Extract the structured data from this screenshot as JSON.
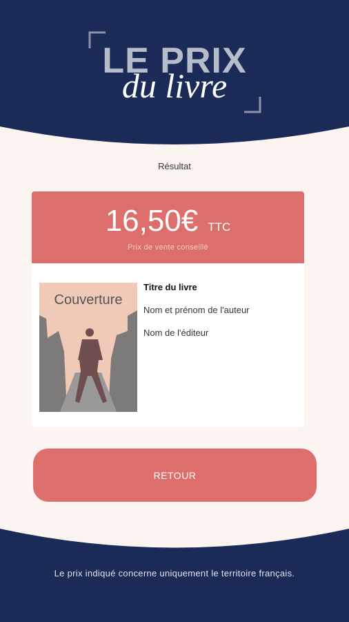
{
  "header": {
    "logo_title": "LE PRIX",
    "logo_subtitle": "du livre"
  },
  "result": {
    "label": "Résultat"
  },
  "price_card": {
    "price": "16,50€",
    "tax_label": "TTC",
    "note": "Prix de vente conseillé",
    "cover_label": "Couverture",
    "book_title": "Titre du livre",
    "author": "Nom et prénom de l'auteur",
    "publisher": "Nom de l'éditeur"
  },
  "actions": {
    "back_label": "RETOUR"
  },
  "footer": {
    "disclaimer": "Le prix indiqué concerne uniquement le territoire français."
  },
  "colors": {
    "navy": "#1b2a57",
    "coral": "#dc6e6c",
    "background": "#fcf4f1"
  }
}
